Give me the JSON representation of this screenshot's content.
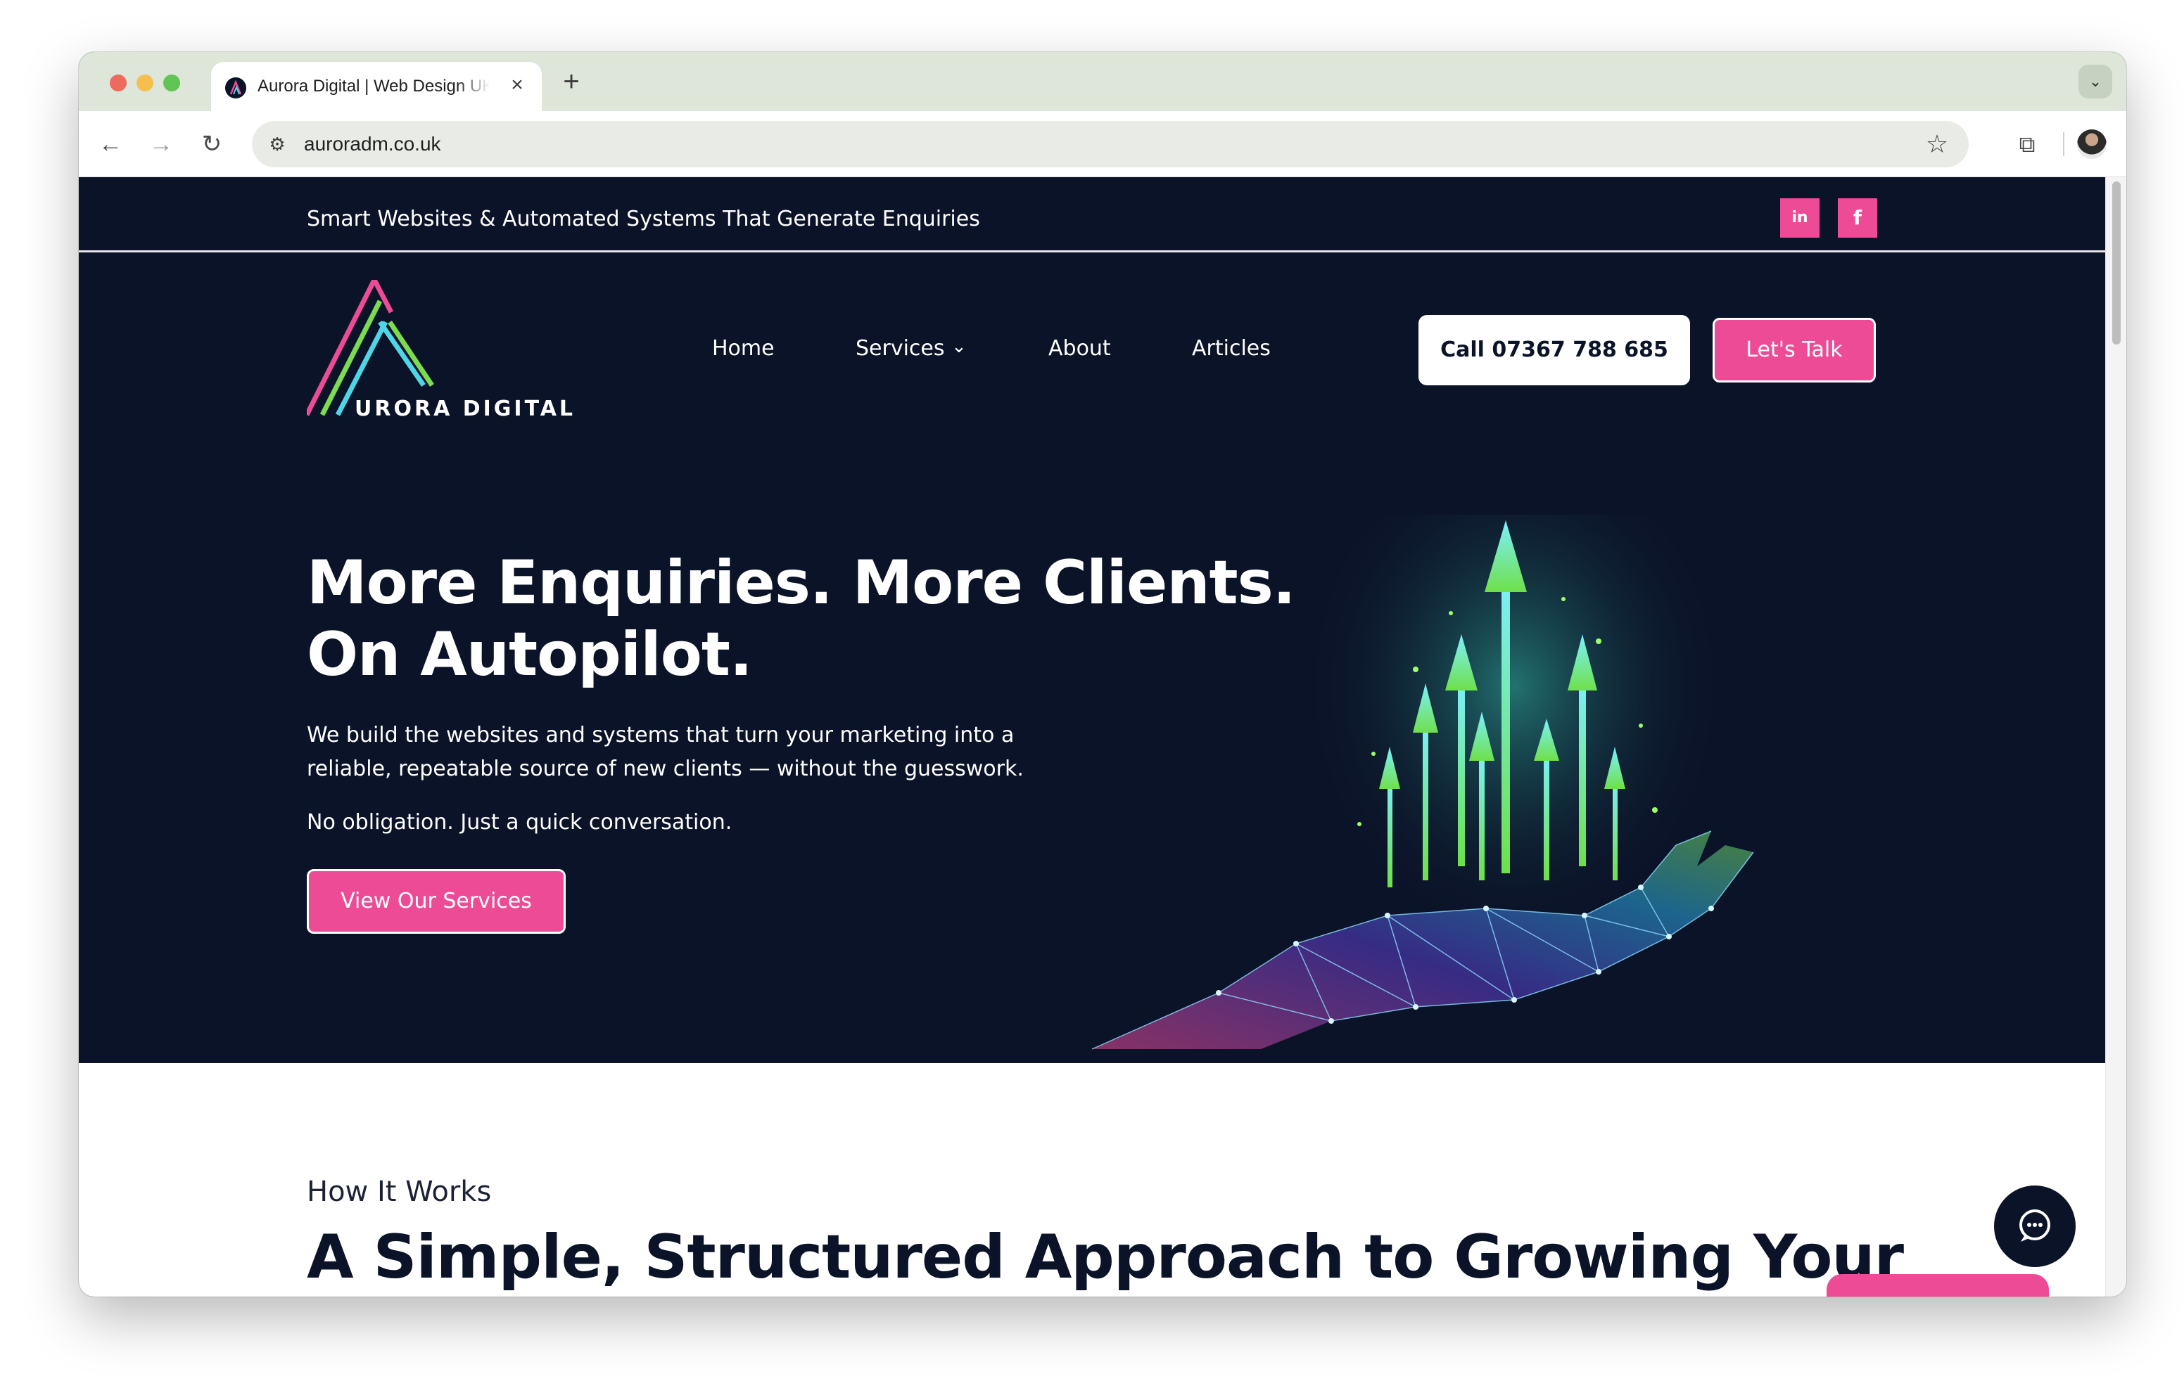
{
  "browser": {
    "tab_title": "Aurora Digital | Web Design UK",
    "tab_close": "×",
    "new_tab": "+",
    "tab_search_icon": "⌄",
    "url": "auroradm.co.uk",
    "back_icon": "←",
    "forward_icon": "→",
    "reload_icon": "↻",
    "site_info_icon": "⚙",
    "star_icon": "☆",
    "extensions_icon": "⧉",
    "menu_icon": "⋮"
  },
  "topbar": {
    "tagline": "Smart Websites & Automated Systems That Generate Enquiries",
    "social": {
      "linkedin": "in",
      "facebook": "f"
    }
  },
  "header": {
    "logo_text": "URORA DIGITAL",
    "nav": {
      "home": "Home",
      "services": "Services",
      "services_chevron": "⌄",
      "about": "About",
      "articles": "Articles"
    },
    "call_button": "Call 07367 788 685",
    "talk_button": "Let's Talk"
  },
  "hero": {
    "heading_line1": "More Enquiries. More Clients.",
    "heading_line2": "On Autopilot.",
    "paragraph": "We build the websites and systems that turn your marketing into a reliable, repeatable source of new clients — without the guesswork.",
    "subtext": "No obligation. Just a quick conversation.",
    "cta": "View Our Services"
  },
  "how_it_works": {
    "label": "How It Works",
    "title": "A Simple, Structured Approach to Growing Your"
  },
  "colors": {
    "navy": "#0b1328",
    "pink": "#ee4b97",
    "green": "#7bdc50",
    "cyan": "#4fd6e6"
  }
}
